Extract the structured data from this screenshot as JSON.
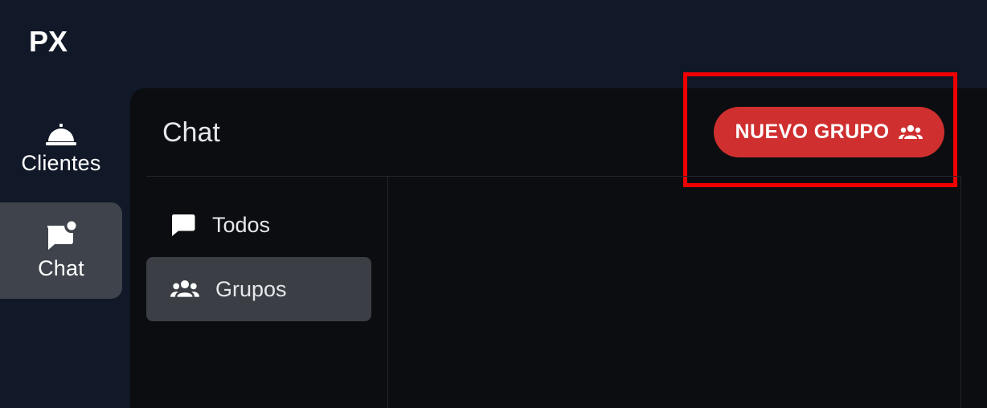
{
  "app": {
    "logo_text": "PX"
  },
  "sidebar": {
    "items": [
      {
        "label": "Clientes",
        "icon": "bell-service-icon"
      },
      {
        "label": "Chat",
        "icon": "chat-notification-icon",
        "active": true
      }
    ]
  },
  "main": {
    "title": "Chat",
    "new_group_label": "NUEVO GRUPO",
    "new_group_icon": "group-icon",
    "accent_color": "#cf2f2f",
    "highlight_color": "#ef0000"
  },
  "chat_filters": {
    "items": [
      {
        "label": "Todos",
        "icon": "chat-bubble-icon"
      },
      {
        "label": "Grupos",
        "icon": "group-icon",
        "selected": true
      }
    ]
  }
}
